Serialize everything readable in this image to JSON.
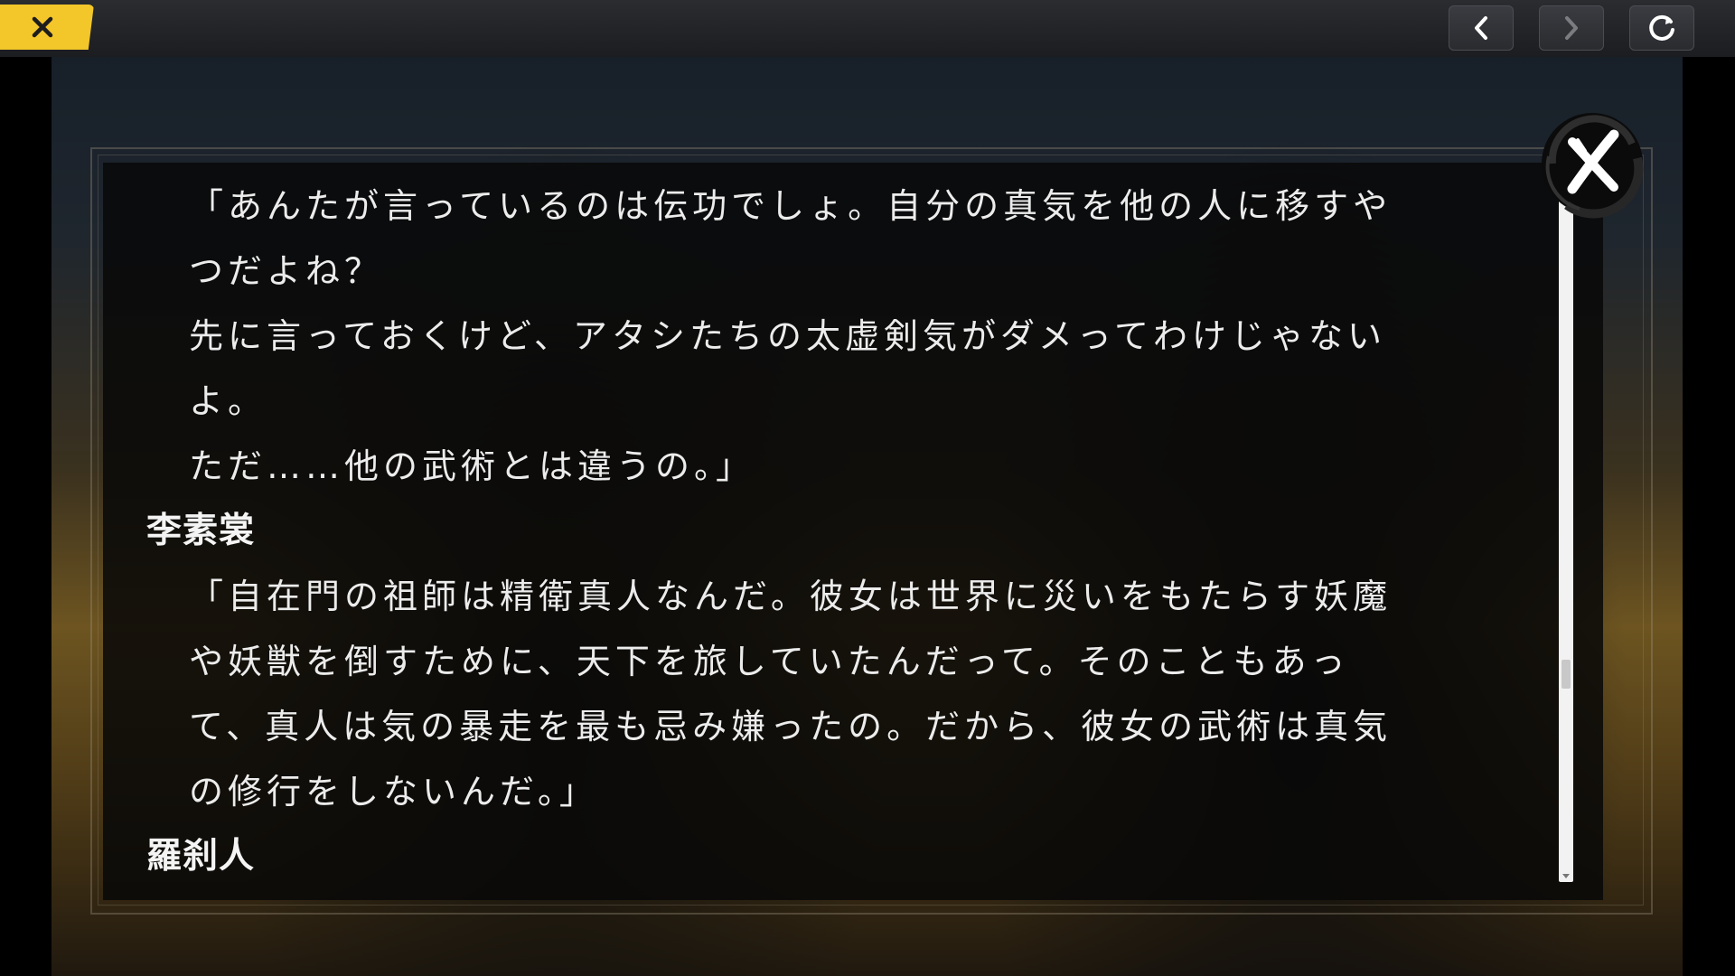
{
  "topbar": {
    "exit_icon": "close-icon",
    "back_icon": "chevron-left-icon",
    "forward_icon": "chevron-right-icon",
    "reload_icon": "reload-icon",
    "accent": "#f3c62a"
  },
  "backlog": {
    "close_icon": "brush-x-icon",
    "entries": [
      {
        "kind": "line",
        "text": "「あんたが言っているのは伝功でしょ。自分の真気を他の人に移すや"
      },
      {
        "kind": "line",
        "text": "つだよね？"
      },
      {
        "kind": "line",
        "text": "先に言っておくけど、アタシたちの太虚剣気がダメってわけじゃない"
      },
      {
        "kind": "line",
        "text": "よ。"
      },
      {
        "kind": "line",
        "text": "ただ……他の武術とは違うの。」"
      },
      {
        "kind": "speaker",
        "text": "李素裳"
      },
      {
        "kind": "line",
        "text": "「自在門の祖師は精衛真人なんだ。彼女は世界に災いをもたらす妖魔"
      },
      {
        "kind": "line",
        "text": "や妖獣を倒すために、天下を旅していたんだって。そのこともあっ"
      },
      {
        "kind": "line",
        "text": "て、真人は気の暴走を最も忌み嫌ったの。だから、彼女の武術は真気"
      },
      {
        "kind": "line",
        "text": "の修行をしないんだ。」"
      },
      {
        "kind": "speaker",
        "text": "羅刹人"
      }
    ],
    "scroll_position": 0.72
  }
}
